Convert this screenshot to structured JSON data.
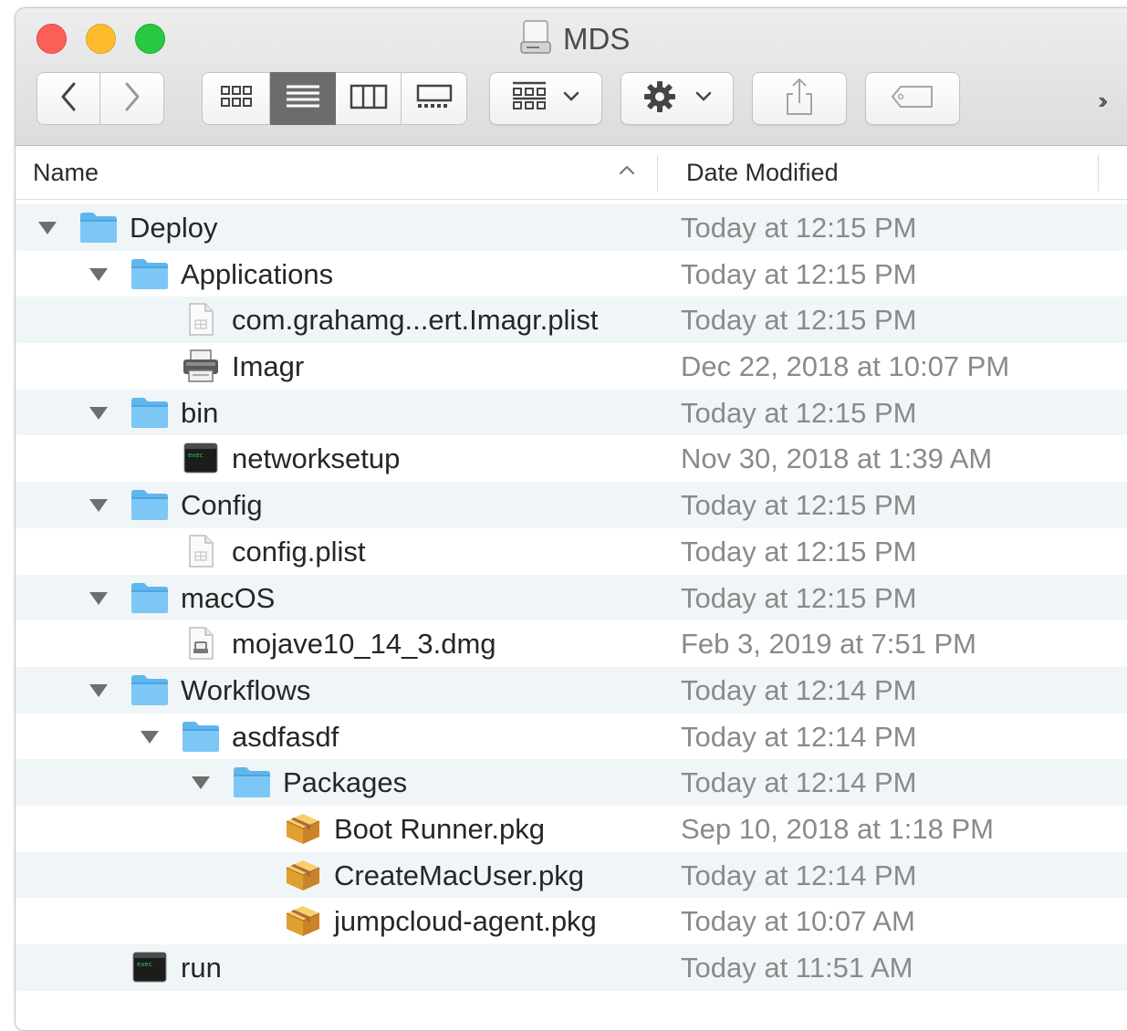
{
  "window": {
    "title": "MDS"
  },
  "toolbar": {
    "back_icon": "chevron-left-icon",
    "forward_icon": "chevron-right-icon",
    "view_modes": [
      "icon-view-icon",
      "list-view-icon",
      "column-view-icon",
      "gallery-view-icon"
    ],
    "active_view": "list-view-icon",
    "group_icon": "group-by-icon",
    "action_icon": "gear-icon",
    "share_icon": "share-icon",
    "tag_icon": "tag-icon",
    "overflow_label": "››"
  },
  "columns": {
    "name": "Name",
    "date_modified": "Date Modified",
    "sort_icon": "sort-ascending-icon"
  },
  "files": [
    {
      "name": "Deploy",
      "date": "Today at 12:15 PM",
      "kind": "folder",
      "indent": 0,
      "expanded": true
    },
    {
      "name": "Applications",
      "date": "Today at 12:15 PM",
      "kind": "folder",
      "indent": 1,
      "expanded": true
    },
    {
      "name": "com.grahamg...ert.Imagr.plist",
      "date": "Today at 12:15 PM",
      "kind": "plist",
      "indent": 2
    },
    {
      "name": "Imagr",
      "date": "Dec 22, 2018 at 10:07 PM",
      "kind": "app",
      "indent": 2
    },
    {
      "name": "bin",
      "date": "Today at 12:15 PM",
      "kind": "folder",
      "indent": 1,
      "expanded": true
    },
    {
      "name": "networksetup",
      "date": "Nov 30, 2018 at 1:39 AM",
      "kind": "exec",
      "indent": 2
    },
    {
      "name": "Config",
      "date": "Today at 12:15 PM",
      "kind": "folder",
      "indent": 1,
      "expanded": true
    },
    {
      "name": "config.plist",
      "date": "Today at 12:15 PM",
      "kind": "plist",
      "indent": 2
    },
    {
      "name": "macOS",
      "date": "Today at 12:15 PM",
      "kind": "folder",
      "indent": 1,
      "expanded": true
    },
    {
      "name": "mojave10_14_3.dmg",
      "date": "Feb 3, 2019 at 7:51 PM",
      "kind": "dmg",
      "indent": 2
    },
    {
      "name": "Workflows",
      "date": "Today at 12:14 PM",
      "kind": "folder",
      "indent": 1,
      "expanded": true
    },
    {
      "name": "asdfasdf",
      "date": "Today at 12:14 PM",
      "kind": "folder",
      "indent": 2,
      "expanded": true
    },
    {
      "name": "Packages",
      "date": "Today at 12:14 PM",
      "kind": "folder",
      "indent": 3,
      "expanded": true
    },
    {
      "name": "Boot Runner.pkg",
      "date": "Sep 10, 2018 at 1:18 PM",
      "kind": "pkg",
      "indent": 4
    },
    {
      "name": "CreateMacUser.pkg",
      "date": "Today at 12:14 PM",
      "kind": "pkg",
      "indent": 4
    },
    {
      "name": "jumpcloud-agent.pkg",
      "date": "Today at 10:07 AM",
      "kind": "pkg",
      "indent": 4
    },
    {
      "name": "run",
      "date": "Today at 11:51 AM",
      "kind": "exec",
      "indent": 1
    }
  ],
  "colors": {
    "folder": "#5fb6ee",
    "row_alt": "#f0f5f7",
    "date_text": "#8a8a8a"
  }
}
